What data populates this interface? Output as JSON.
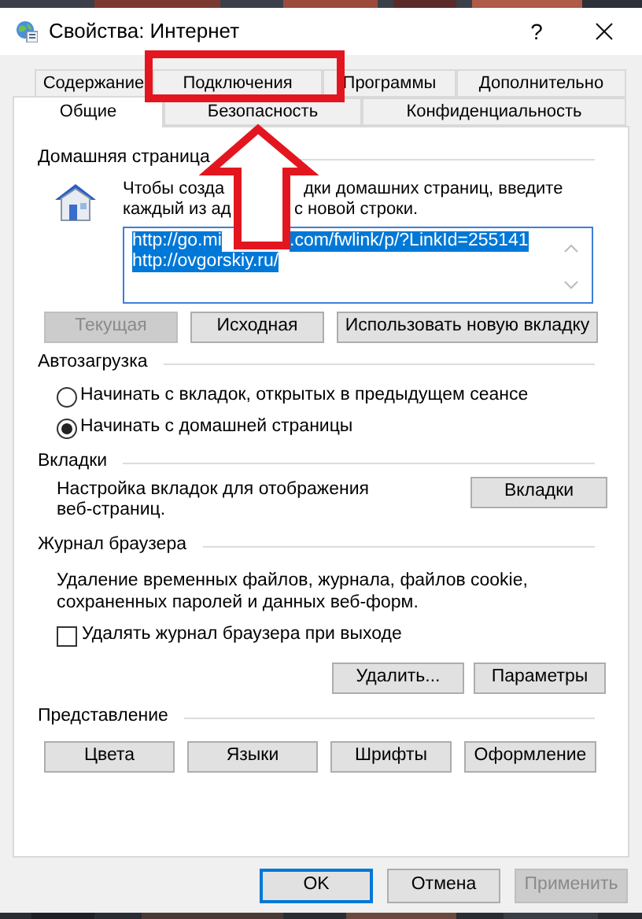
{
  "window": {
    "title": "Свойства: Интернет",
    "help_label": "?"
  },
  "tab_rows": [
    [
      {
        "label": "Содержание",
        "selected": false
      },
      {
        "label": "Подключения",
        "selected": false
      },
      {
        "label": "Программы",
        "selected": false
      },
      {
        "label": "Дополнительно",
        "selected": false
      }
    ],
    [
      {
        "label": "Общие",
        "selected": true
      },
      {
        "label": "Безопасность",
        "selected": false
      },
      {
        "label": "Конфиденциальность",
        "selected": false
      }
    ]
  ],
  "home_page": {
    "heading": "Домашняя страница",
    "description_lines": [
      [
        "Чтобы созда",
        "дки домашних страниц, введите"
      ],
      [
        "каждый из ад",
        "с новой строки."
      ]
    ],
    "urls": [
      {
        "fragments": [
          "http://go.mi",
          ".com/fwlink/p/?LinkId=255141"
        ]
      },
      {
        "fragments": [
          "http://ovgorskiy.ru/"
        ]
      }
    ],
    "urls_selected": true,
    "buttons": [
      {
        "label": "Текущая",
        "disabled": true
      },
      {
        "label": "Исходная",
        "disabled": false
      },
      {
        "label": "Использовать новую вкладку",
        "disabled": false
      }
    ]
  },
  "startup": {
    "heading": "Автозагрузка",
    "options": [
      {
        "label": "Начинать с вкладок, открытых в предыдущем сеансе",
        "selected": false
      },
      {
        "label": "Начинать с домашней страницы",
        "selected": true
      }
    ]
  },
  "tabs_section": {
    "heading": "Вкладки",
    "description_lines": [
      "Настройка вкладок для отображения",
      "веб-страниц."
    ],
    "button": "Вкладки"
  },
  "history": {
    "heading": "Журнал браузера",
    "description_lines": [
      "Удаление временных файлов, журнала, файлов cookie,",
      "сохраненных паролей и данных веб-форм."
    ],
    "delete_on_exit": {
      "label": "Удалять журнал браузера при выходе",
      "checked": false
    },
    "buttons": [
      "Удалить...",
      "Параметры"
    ]
  },
  "appearance": {
    "heading": "Представление",
    "buttons": [
      "Цвета",
      "Языки",
      "Шрифты",
      "Оформление"
    ]
  },
  "footer_buttons": [
    {
      "label": "OK",
      "default": true,
      "disabled": false
    },
    {
      "label": "Отмена",
      "default": false,
      "disabled": false
    },
    {
      "label": "Применить",
      "default": false,
      "disabled": true
    }
  ]
}
